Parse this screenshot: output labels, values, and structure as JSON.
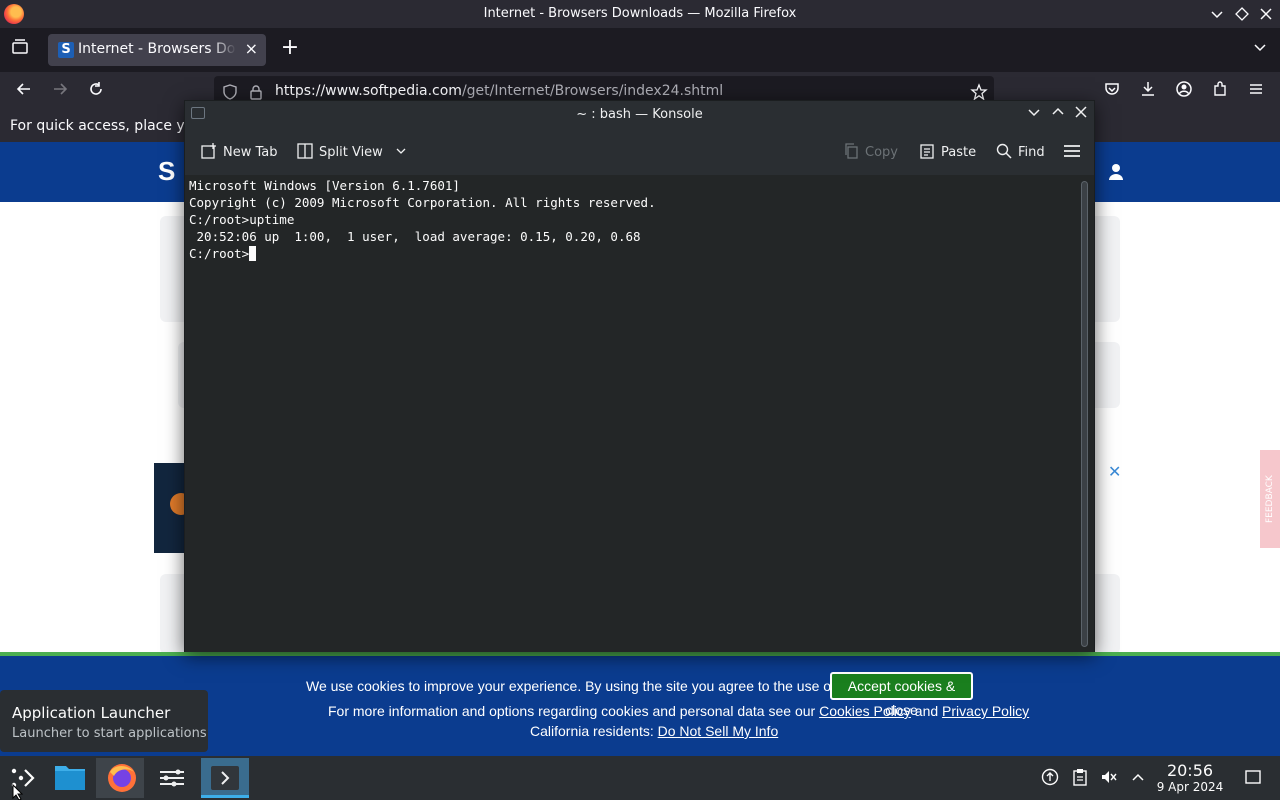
{
  "firefox": {
    "window_title": "Internet - Browsers Downloads — Mozilla Firefox",
    "tab_label": "Internet - Browsers Downloads",
    "tab_close": "×",
    "new_tab": "+",
    "url_domain": "https://www.softpedia.com",
    "url_path": "/get/Internet/Browsers/index24.shtml",
    "bookmarks_text": "For quick access, place yo"
  },
  "konsole": {
    "title": "~ : bash — Konsole",
    "toolbar": {
      "new_tab": "New Tab",
      "split_view": "Split View",
      "copy": "Copy",
      "paste": "Paste",
      "find": "Find"
    },
    "terminal_lines": [
      "Microsoft Windows [Version 6.1.7601]",
      "Copyright (c) 2009 Microsoft Corporation. All rights reserved.",
      "",
      "C:/root>uptime",
      " 20:52:06 up  1:00,  1 user,  load average: 0.15, 0.20, 0.68"
    ],
    "prompt": "C:/root>"
  },
  "cookie_banner": {
    "line1": "We use cookies to improve your experience. By using the site you agree to the use of cookies.",
    "accept_button": "Accept cookies & close",
    "line2_prefix": "For more information and options regarding cookies and personal data see our",
    "cookies_policy": "Cookies Policy",
    "and": "and",
    "privacy_policy": "Privacy Policy",
    "line3_prefix": "California residents:",
    "do_not_sell": "Do Not Sell My Info"
  },
  "feedback_label": "FEEDBACK",
  "launcher_tooltip": {
    "title": "Application Launcher",
    "subtitle": "Launcher to start applications"
  },
  "taskbar": {
    "time": "20:56",
    "date": "9 Apr 2024"
  },
  "colors": {
    "site_blue": "#0b3c8f",
    "accept_green": "#1a7f1e",
    "konsole_bg": "#232627"
  }
}
